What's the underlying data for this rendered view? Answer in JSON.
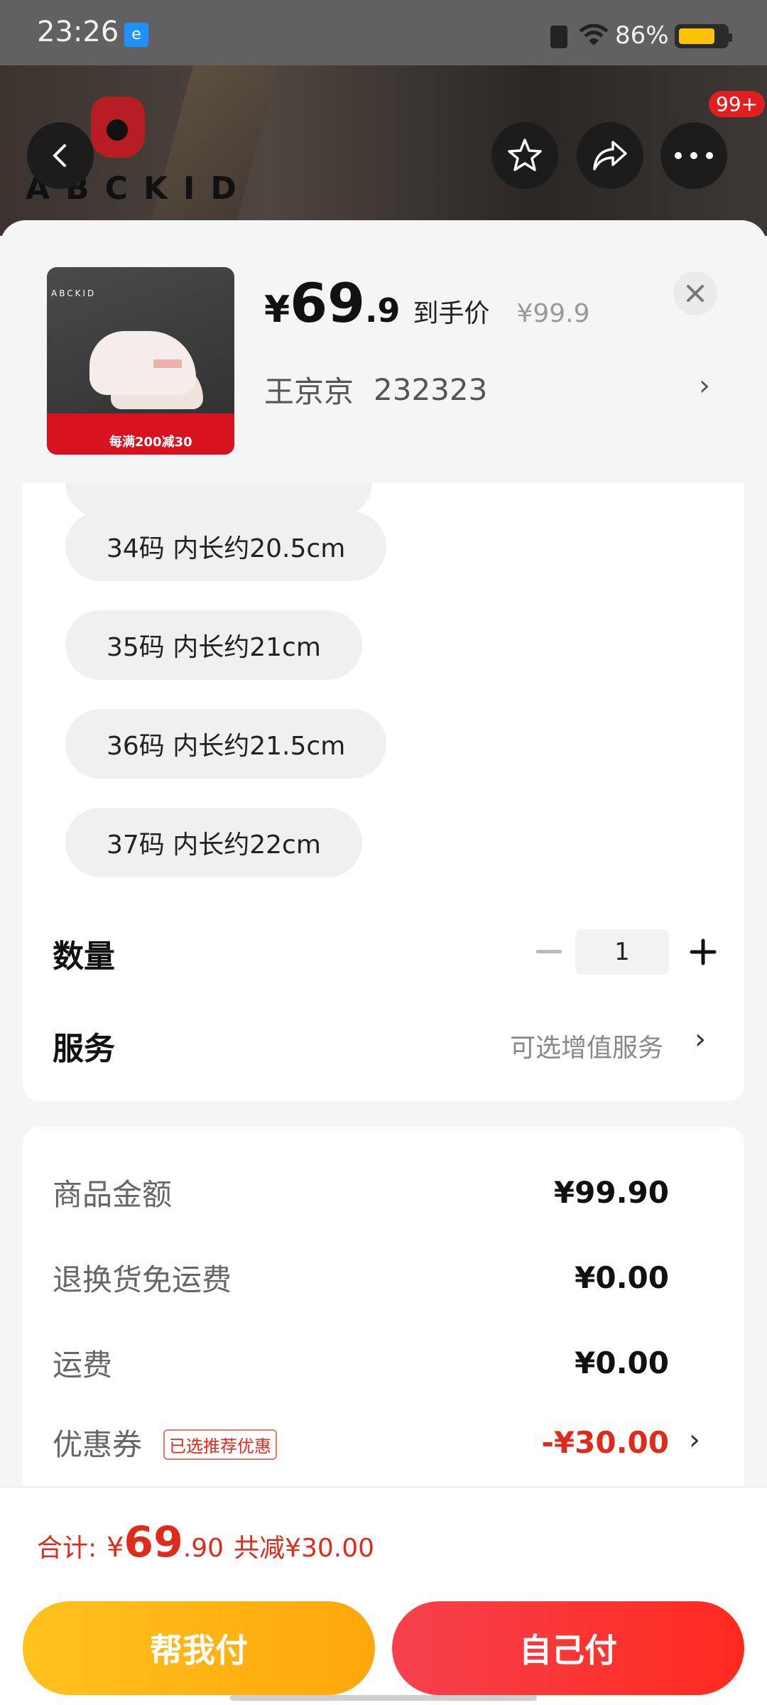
{
  "status_bar": {
    "time": "23:26",
    "app_icon": "e",
    "battery_percent": "86%",
    "icons": [
      "sim-icon",
      "wifi-icon",
      "battery-icon"
    ],
    "battery_level": 0.86
  },
  "header": {
    "brand_logo_text": "ABCKID",
    "more_badge": "99+",
    "icons": [
      "back-icon",
      "star-icon",
      "share-icon",
      "more-icon"
    ]
  },
  "product": {
    "thumb_brand": "ABCKID",
    "thumb_promo": "每满200减30",
    "price_yen": "¥",
    "price_int": "69",
    "price_dec": ".9",
    "price_label": "到手价",
    "original_price": "¥99.9",
    "spec_name": "王京京",
    "spec_value": "232323"
  },
  "sizes": [
    {
      "label": "34码 内长约20.5cm"
    },
    {
      "label": "35码 内长约21cm"
    },
    {
      "label": "36码 内长约21.5cm"
    },
    {
      "label": "37码 内长约22cm"
    }
  ],
  "quantity": {
    "label": "数量",
    "value": "1"
  },
  "service": {
    "label": "服务",
    "hint": "可选增值服务",
    "arrow": "›"
  },
  "summary": {
    "rows": [
      {
        "label": "商品金额",
        "value": "¥99.90"
      },
      {
        "label": "退换货免运费",
        "value": "¥0.00"
      },
      {
        "label": "运费",
        "value": "¥0.00"
      }
    ],
    "coupon": {
      "label": "优惠券",
      "tag": "已选推荐优惠",
      "value": "-¥30.00",
      "arrow": "›"
    }
  },
  "total": {
    "label": "合计:",
    "yen": "¥",
    "int": "69",
    "dec": ".90",
    "saving": "共减¥30.00"
  },
  "buttons": {
    "help_pay": "帮我付",
    "self_pay": "自己付"
  },
  "colors": {
    "accent_red": "#e02a1c",
    "help_button": "#ffb414",
    "self_button": "#f6374a"
  }
}
